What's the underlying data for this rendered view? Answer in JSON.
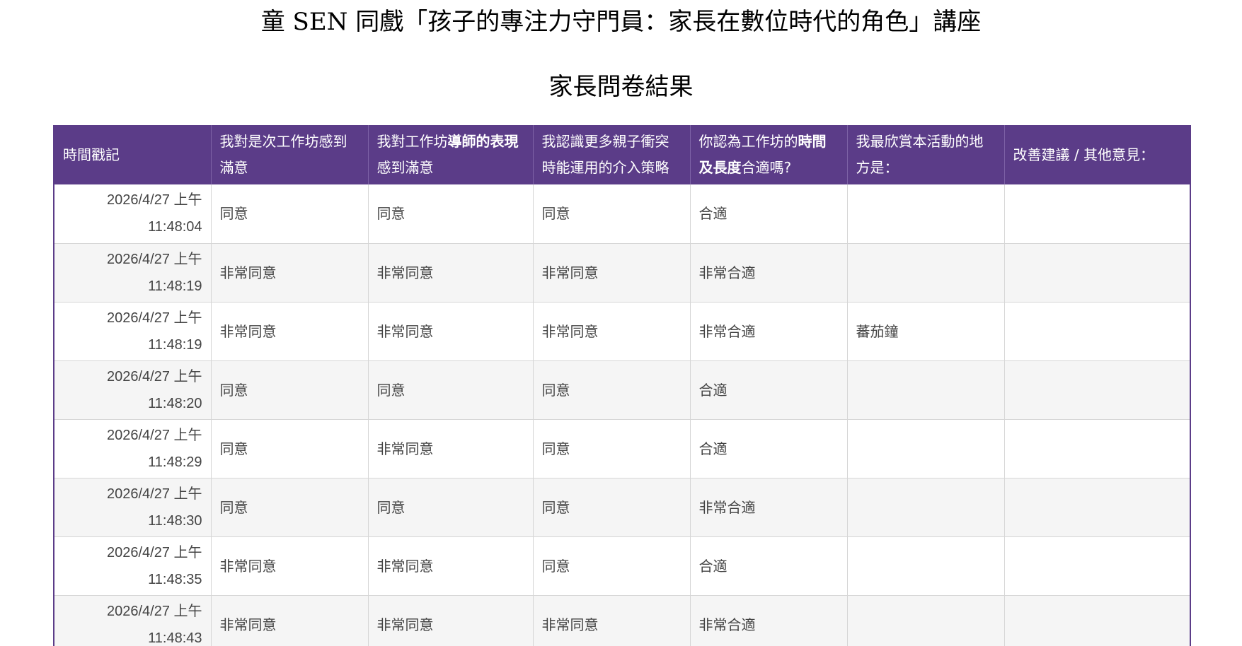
{
  "title": "童 SEN 同戲「孩子的專注力守門員：家長在數位時代的角色」講座",
  "subtitle": "家長問卷結果",
  "columns": {
    "c0": "時間戳記",
    "c1": "我對是次工作坊感到滿意",
    "c2_pre": "我對工作坊",
    "c2_bold": "導師的表現",
    "c2_post": "感到滿意",
    "c3": "我認識更多親子衝突時能運用的介入策略",
    "c4_pre": "你認為工作坊的",
    "c4_bold": "時間及長度",
    "c4_post": "合適嗎?",
    "c5": "我最欣賞本活動的地方是：",
    "c6": "改善建議 / 其他意見："
  },
  "rows": [
    {
      "date": "2026/4/27 上午",
      "time": "11:48:04",
      "q1": "同意",
      "q2": "同意",
      "q3": "同意",
      "q4": "合適",
      "q5": "",
      "q6": ""
    },
    {
      "date": "2026/4/27 上午",
      "time": "11:48:19",
      "q1": "非常同意",
      "q2": "非常同意",
      "q3": "非常同意",
      "q4": "非常合適",
      "q5": "",
      "q6": ""
    },
    {
      "date": "2026/4/27 上午",
      "time": "11:48:19",
      "q1": "非常同意",
      "q2": "非常同意",
      "q3": "非常同意",
      "q4": "非常合適",
      "q5": "蕃茄鐘",
      "q6": ""
    },
    {
      "date": "2026/4/27 上午",
      "time": "11:48:20",
      "q1": "同意",
      "q2": "同意",
      "q3": "同意",
      "q4": "合適",
      "q5": "",
      "q6": ""
    },
    {
      "date": "2026/4/27 上午",
      "time": "11:48:29",
      "q1": "同意",
      "q2": "非常同意",
      "q3": "同意",
      "q4": "合適",
      "q5": "",
      "q6": ""
    },
    {
      "date": "2026/4/27 上午",
      "time": "11:48:30",
      "q1": "同意",
      "q2": "同意",
      "q3": "同意",
      "q4": "非常合適",
      "q5": "",
      "q6": ""
    },
    {
      "date": "2026/4/27 上午",
      "time": "11:48:35",
      "q1": "非常同意",
      "q2": "非常同意",
      "q3": "同意",
      "q4": "合適",
      "q5": "",
      "q6": ""
    },
    {
      "date": "2026/4/27 上午",
      "time": "11:48:43",
      "q1": "非常同意",
      "q2": "非常同意",
      "q3": "非常同意",
      "q4": "非常合適",
      "q5": "",
      "q6": ""
    }
  ],
  "colors": {
    "header_bg": "#5b3c88",
    "header_text": "#ffffff",
    "row_alt_bg": "#f5f5f5"
  }
}
